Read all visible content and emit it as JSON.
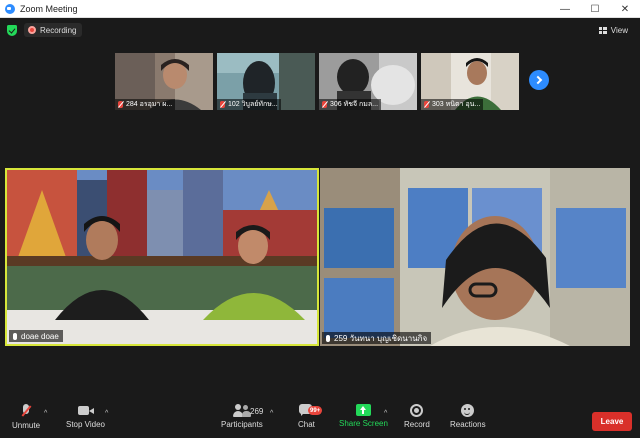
{
  "window": {
    "title": "Zoom Meeting",
    "minimize": "—",
    "maximize": "☐",
    "close": "✕"
  },
  "status": {
    "recording_label": "Recording",
    "view_label": "View"
  },
  "thumbnails": [
    {
      "name": "284 อรอุมา ผ..."
    },
    {
      "name": "102 วิบูลย์ทักษ..."
    },
    {
      "name": "306 ทัชจี กมล..."
    },
    {
      "name": "303 หนิตา อุน..."
    }
  ],
  "main_tiles": [
    {
      "name": "doae doae"
    },
    {
      "name": "259 วันทนา บุญเชิดนานกิจ"
    }
  ],
  "toolbar": {
    "unmute": "Unmute",
    "stop_video": "Stop Video",
    "participants": "Participants",
    "participant_count": "269",
    "chat": "Chat",
    "chat_badge": "99+",
    "share_screen": "Share Screen",
    "record": "Record",
    "reactions": "Reactions",
    "caret": "^",
    "leave": "Leave"
  },
  "colors": {
    "accent_blue": "#2d8cff",
    "share_green": "#23d959",
    "leave_red": "#d9302a",
    "active_speaker": "#d7e63a"
  }
}
